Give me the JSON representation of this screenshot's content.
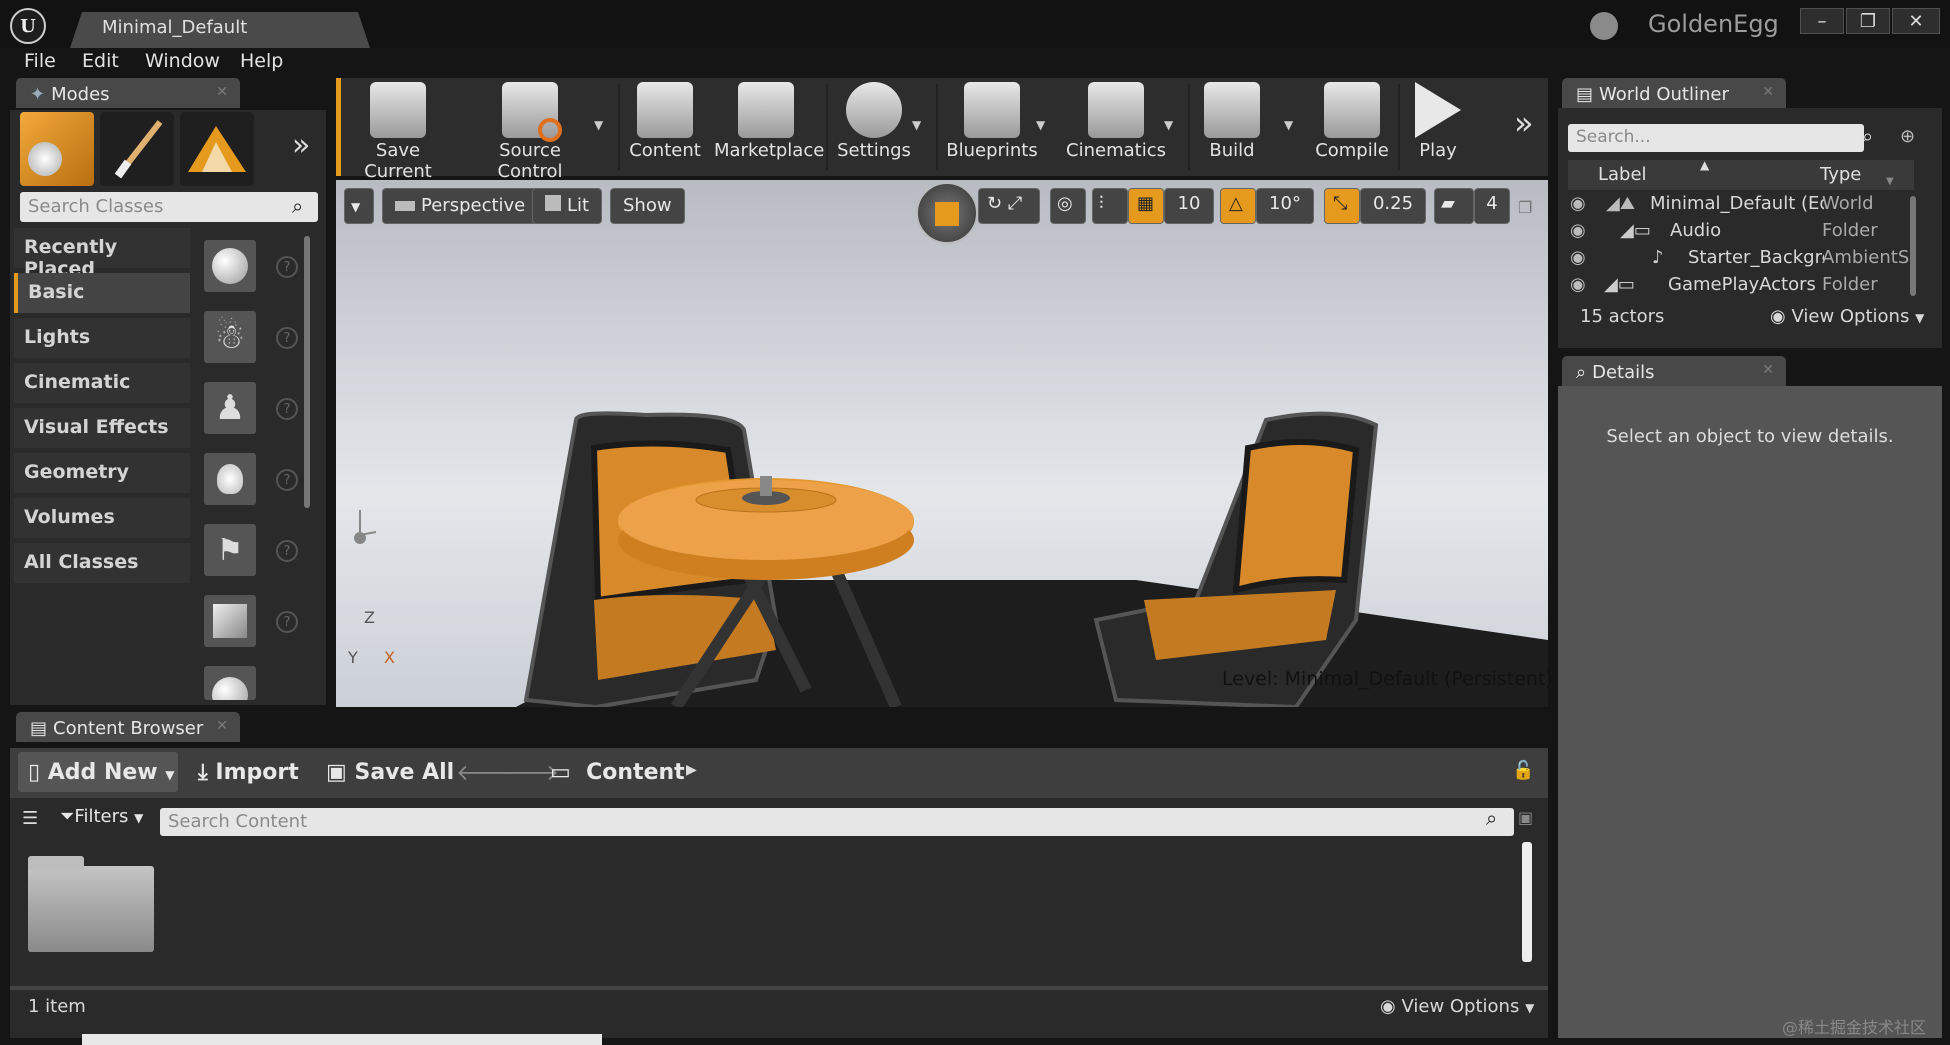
{
  "title_bar": {
    "logo": "U",
    "document_tab": "Minimal_Default",
    "project_name": "GoldenEgg",
    "window_buttons": [
      "–",
      "❐",
      "✕"
    ]
  },
  "menu": [
    "File",
    "Edit",
    "Window",
    "Help"
  ],
  "modes": {
    "tab_label": "Modes",
    "mode_icons": [
      "place-icon",
      "paint-icon",
      "landscape-icon"
    ],
    "expand_label": "»",
    "search_placeholder": "Search Classes",
    "categories": [
      "Recently Placed",
      "Basic",
      "Lights",
      "Cinematic",
      "Visual Effects",
      "Geometry",
      "Volumes",
      "All Classes"
    ],
    "active_category": "Basic",
    "thumbnails": [
      "sphere-icon",
      "mannequin-icon",
      "pawn-icon",
      "light-bulb-icon",
      "player-start-icon",
      "cube-icon",
      "sphere-icon"
    ]
  },
  "toolbar": {
    "buttons": [
      "Save Current",
      "Source Control",
      "Content",
      "Marketplace",
      "Settings",
      "Blueprints",
      "Cinematics",
      "Build",
      "Compile",
      "Play"
    ],
    "expand_label": "»"
  },
  "viewport": {
    "perspective_label": "Perspective",
    "lit_label": "Lit",
    "show_label": "Show",
    "grid_snap": "10",
    "rotation_snap": "10°",
    "scale_snap": "0.25",
    "camera_speed": "4",
    "level_prefix": "Level:",
    "level_name": "Minimal_Default (Persistent)",
    "axes": [
      "Z",
      "Y",
      "X"
    ]
  },
  "world_outliner": {
    "tab_label": "World Outliner",
    "search_placeholder": "Search...",
    "col_label": "Label",
    "col_type": "Type",
    "rows": [
      {
        "label": "Minimal_Default (Ed",
        "type": "World"
      },
      {
        "label": "Audio",
        "type": "Folder"
      },
      {
        "label": "Starter_Backgrc",
        "type": "AmbientSo"
      },
      {
        "label": "GamePlayActors",
        "type": "Folder"
      }
    ],
    "actor_count": "15 actors",
    "view_options": "View Options"
  },
  "details": {
    "tab_label": "Details",
    "empty_message": "Select an object to view details."
  },
  "content_browser": {
    "tab_label": "Content Browser",
    "add_new": "Add New",
    "import": "Import",
    "save_all": "Save All",
    "path": "Content",
    "filters": "Filters",
    "search_placeholder": "Search Content",
    "item_count": "1 item",
    "view_options": "View Options"
  },
  "watermark": "@稀土掘金技术社区",
  "colors": {
    "accent": "#e59a1e",
    "chair": "#d88a2a",
    "panel": "#3e3e3e"
  }
}
